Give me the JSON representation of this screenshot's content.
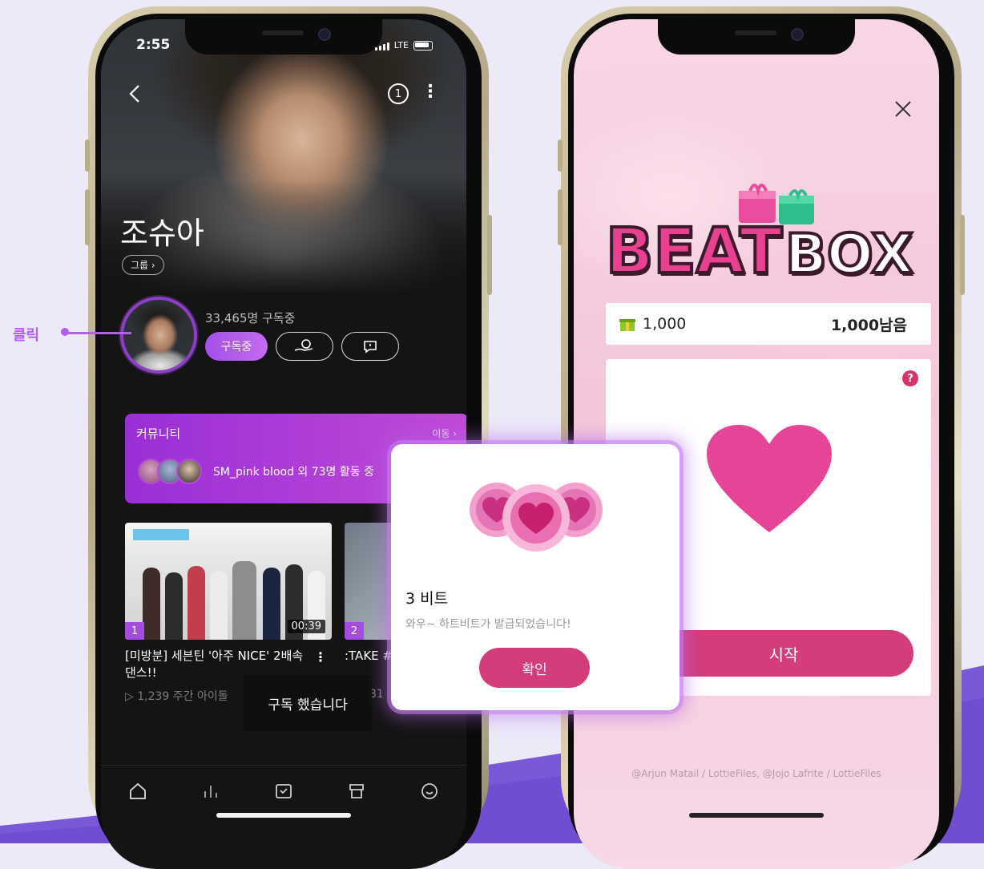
{
  "annotation": {
    "label": "클릭"
  },
  "left_phone": {
    "status": {
      "time": "2:55",
      "network": "LTE"
    },
    "header": {
      "back_icon": "chevron-left-icon",
      "notification_count": "1",
      "more_icon": "kebab-icon"
    },
    "artist": {
      "name": "조슈아",
      "group_chip": "그룹 ›"
    },
    "subscription": {
      "count_text": "33,465명 구독중",
      "subscribed_label": "구독중"
    },
    "community": {
      "title": "커뮤니티",
      "move_label": "이동 ›",
      "activity_text": "SM_pink blood  외 73명 활동 중"
    },
    "videos": [
      {
        "rank": "1",
        "duration": "00:39",
        "title": "[미방분] 세븐틴 '아주 NICE' 2배속댄스!!",
        "meta": "▷ 1,239   주간 아이돌"
      },
      {
        "rank": "2",
        "title": ":TAKE #  ni Al",
        "meta": "981"
      }
    ],
    "toast": "구독 했습니다",
    "tabbar": [
      "home-icon",
      "chart-icon",
      "inbox-icon",
      "store-icon",
      "profile-icon"
    ]
  },
  "right_phone": {
    "logo_text": {
      "beat": "BEAT",
      "box": "BOX"
    },
    "counter": {
      "left": "1,000",
      "right": "1,000남음"
    },
    "help_label": "?",
    "start_label": "시작",
    "credits": "@Arjun Matail / LottieFiles, @Jojo Lafrite / LottieFiles"
  },
  "dialog": {
    "title": "3 비트",
    "message": "와우~ 하트비트가 발급되었습니다!",
    "confirm_label": "확인"
  },
  "colors": {
    "accent_purple": "#a24de0",
    "accent_pink": "#d43c7c",
    "annotation": "#b25ef0"
  }
}
